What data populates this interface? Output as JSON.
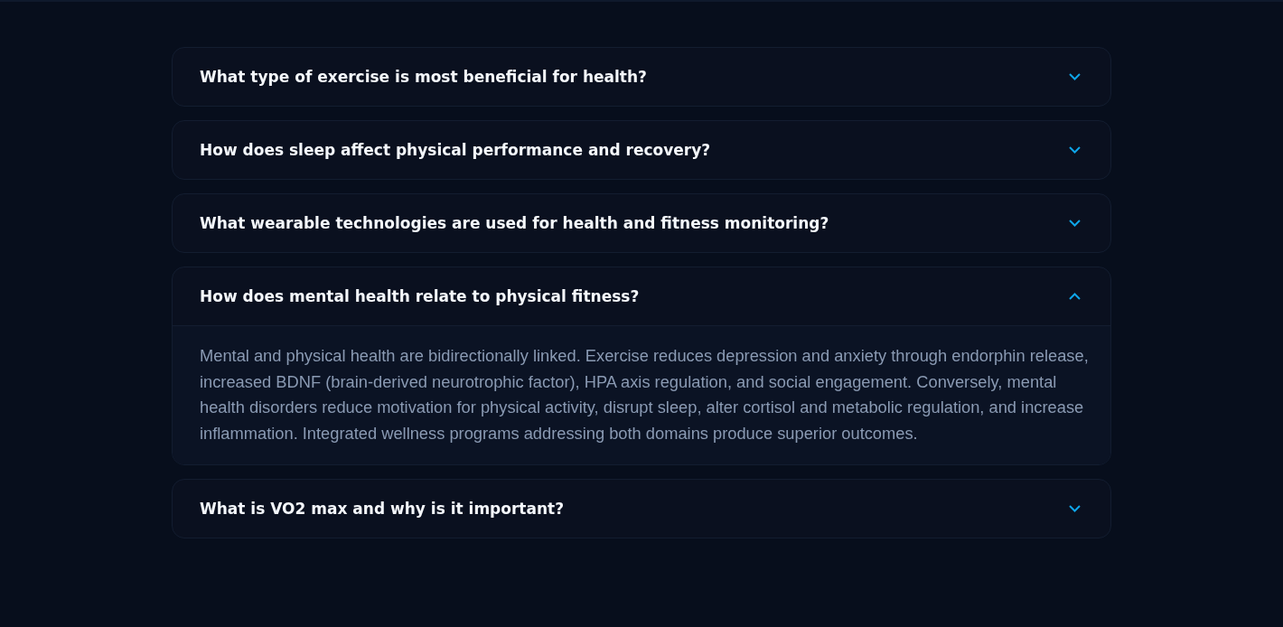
{
  "faqs": [
    {
      "question": "What type of exercise is most beneficial for health?",
      "expanded": false
    },
    {
      "question": "How does sleep affect physical performance and recovery?",
      "expanded": false
    },
    {
      "question": "What wearable technologies are used for health and fitness monitoring?",
      "expanded": false
    },
    {
      "question": "How does mental health relate to physical fitness?",
      "expanded": true,
      "answer": "Mental and physical health are bidirectionally linked. Exercise reduces depression and anxiety through endorphin release, increased BDNF (brain-derived neurotrophic factor), HPA axis regulation, and social engagement. Conversely, mental health disorders reduce motivation for physical activity, disrupt sleep, alter cortisol and metabolic regulation, and increase inflammation. Integrated wellness programs addressing both domains produce superior outcomes."
    },
    {
      "question": "What is VO2 max and why is it important?",
      "expanded": false
    }
  ]
}
